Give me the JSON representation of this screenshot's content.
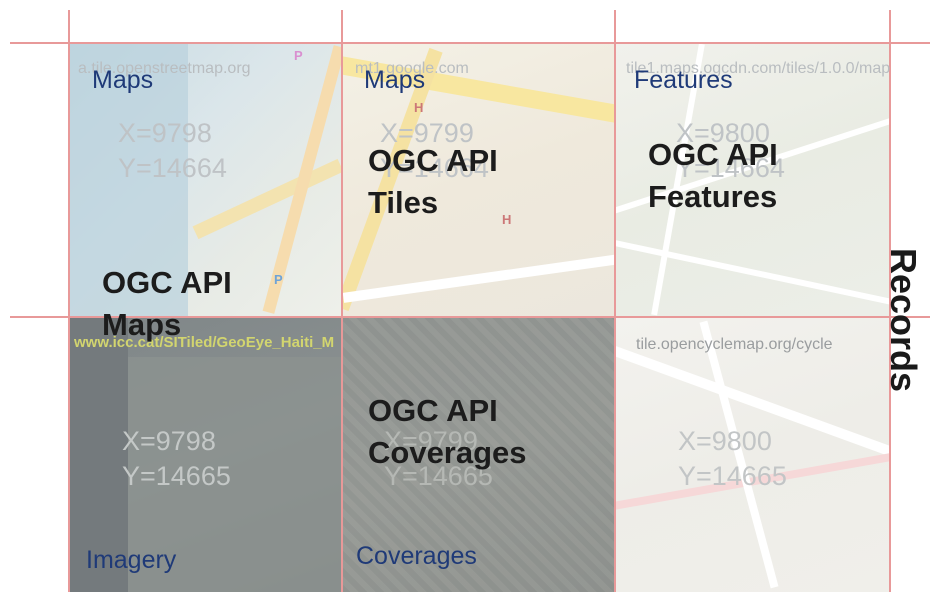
{
  "tiles": [
    {
      "source": "a.tile.openstreetmap.org",
      "x": "X=9798",
      "y": "Y=14664",
      "type": "Maps"
    },
    {
      "source": "mt1.google.com",
      "x": "X=9799",
      "y": "Y=14664",
      "type": "Maps"
    },
    {
      "source": "tile1.maps.ogcdn.com/tiles/1.0.0/map",
      "x": "X=9800",
      "y": "Y=14664",
      "type": "Features"
    },
    {
      "source": "www.icc.cat/SITiled/GeoEye_Haiti_M",
      "x": "X=9798",
      "y": "Y=14665",
      "type": "Imagery"
    },
    {
      "source": "",
      "x": "X=9799",
      "y": "Y=14665",
      "type": "Coverages"
    },
    {
      "source": "tile.opencyclemap.org/cycle",
      "x": "X=9800",
      "y": "Y=14665",
      "type": ""
    }
  ],
  "apis": {
    "maps": {
      "line1": "OGC API",
      "line2": "Maps"
    },
    "tiles": {
      "line1": "OGC API",
      "line2": "Tiles"
    },
    "features": {
      "line1": "OGC API",
      "line2": "Features"
    },
    "coverages": {
      "line1": "OGC API",
      "line2": "Coverages"
    }
  },
  "records_label": "Records",
  "colors": {
    "type_label": "#1f3a78",
    "grid_line": "#e89999",
    "api_label": "#1c1c1c"
  }
}
